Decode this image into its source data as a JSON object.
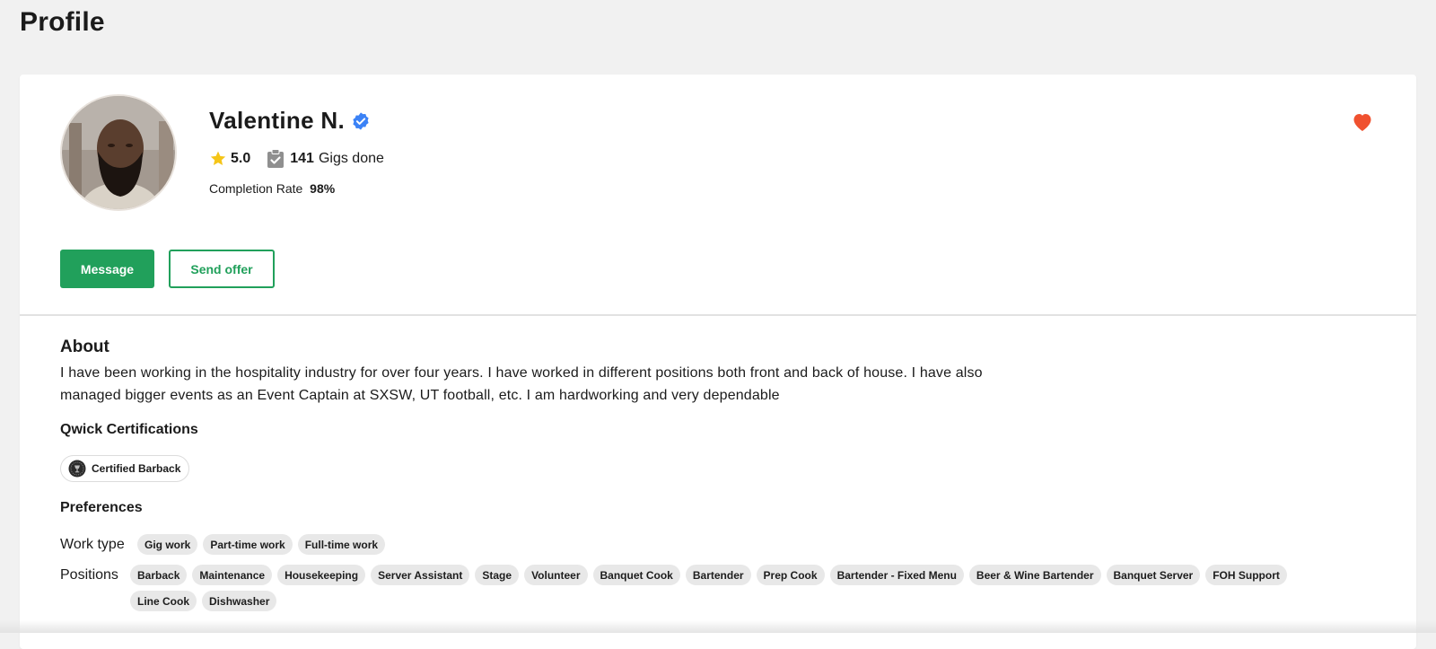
{
  "page": {
    "title": "Profile"
  },
  "profile": {
    "name": "Valentine N.",
    "rating": "5.0",
    "gigs_count": "141",
    "gigs_label": "Gigs done",
    "completion_label": "Completion Rate",
    "completion_value": "98%",
    "verified": true,
    "favorited": true
  },
  "actions": {
    "message_label": "Message",
    "send_offer_label": "Send offer"
  },
  "about": {
    "title": "About",
    "text": "I have been working in the hospitality industry for over four years. I have worked in different positions both front and back of house. I have also managed bigger events as an Event Captain at SXSW, UT football, etc. I am hardworking and very dependable"
  },
  "certifications": {
    "title": "Qwick Certifications",
    "items": [
      "Certified Barback"
    ]
  },
  "preferences": {
    "title": "Preferences",
    "work_type_label": "Work type",
    "work_types": [
      "Gig work",
      "Part-time work",
      "Full-time work"
    ],
    "positions_label": "Positions",
    "positions": [
      "Barback",
      "Maintenance",
      "Housekeeping",
      "Server Assistant",
      "Stage",
      "Volunteer",
      "Banquet Cook",
      "Bartender",
      "Prep Cook",
      "Bartender - Fixed Menu",
      "Beer & Wine Bartender",
      "Banquet Server",
      "FOH Support",
      "Line Cook",
      "Dishwasher"
    ]
  },
  "colors": {
    "primary_green": "#21a05b",
    "verified_blue": "#3b82f6",
    "star_yellow": "#f5c518",
    "heart_red": "#f0512f",
    "page_background": "#f1f1f1"
  },
  "icons": [
    "verified-badge-icon",
    "star-icon",
    "clipboard-check-icon",
    "heart-icon",
    "certification-seal-icon"
  ]
}
